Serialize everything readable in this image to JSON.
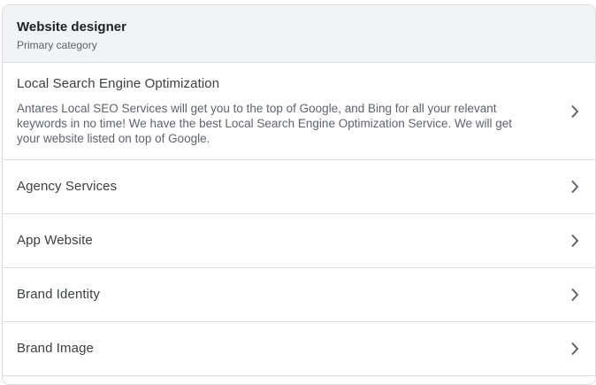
{
  "header": {
    "title": "Website designer",
    "subtitle": "Primary category"
  },
  "services": [
    {
      "title": "Local Search Engine Optimization",
      "description": "Antares Local SEO Services will get you to the top of Google, and Bing for all your relevant keywords in no time! We have the best Local Search Engine Optimization Service. We will get your website listed on top of Google."
    },
    {
      "title": "Agency Services"
    },
    {
      "title": "App Website"
    },
    {
      "title": "Brand Identity"
    },
    {
      "title": "Brand Image"
    }
  ],
  "icons": {
    "row_action": "chevron-right-icon"
  },
  "colors": {
    "header_bg": "#f1f3f4",
    "divider": "#dadce0",
    "title_text": "#202124",
    "row_text": "#3c4043",
    "secondary_text": "#5f6368"
  }
}
